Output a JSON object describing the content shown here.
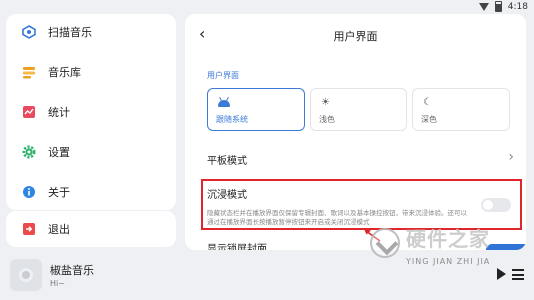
{
  "status": {
    "time": "4:18"
  },
  "sidebar": {
    "items": [
      {
        "label": "扫描音乐",
        "icon": "scan-music-icon"
      },
      {
        "label": "音乐库",
        "icon": "music-library-icon"
      },
      {
        "label": "统计",
        "icon": "stats-icon"
      },
      {
        "label": "设置",
        "icon": "settings-gear-icon"
      },
      {
        "label": "关于",
        "icon": "info-icon"
      }
    ],
    "exit_label": "退出"
  },
  "player": {
    "title": "椒盐音乐",
    "artist": "Hi~"
  },
  "page": {
    "title": "用户界面",
    "section": "用户界面",
    "theme_options": [
      {
        "label": "跟随系统",
        "icon": "android-icon",
        "selected": true
      },
      {
        "label": "浅色",
        "icon": "sun-icon",
        "selected": false
      },
      {
        "label": "深色",
        "icon": "moon-icon",
        "selected": false
      }
    ],
    "tablet_mode": "平板模式",
    "immersive": {
      "title": "沉浸模式",
      "description": "隐藏状态栏并在播放界面仅保留专辑封面、歌词以及基本操控按钮，带来沉浸体验。还可以通过在播放界面长按播放暂停按钮来开启或关闭沉浸模式",
      "enabled": false
    },
    "next_row_partial": "显示锁屏封面"
  },
  "watermark": {
    "title": "硬件之家",
    "pinyin": "YING JIAN ZHI JIA"
  },
  "colors": {
    "accent": "#3b7ad8",
    "highlight": "#e0262a",
    "background": "#eef0f4"
  }
}
